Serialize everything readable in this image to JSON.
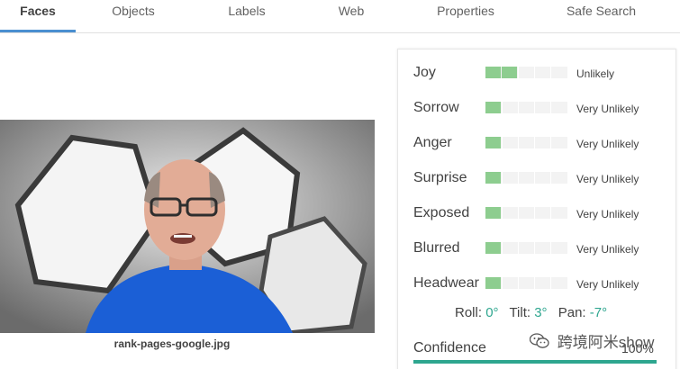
{
  "tabs": [
    {
      "label": "Faces",
      "active": true
    },
    {
      "label": "Objects",
      "active": false
    },
    {
      "label": "Labels",
      "active": false
    },
    {
      "label": "Web",
      "active": false
    },
    {
      "label": "Properties",
      "active": false
    },
    {
      "label": "Safe Search",
      "active": false
    }
  ],
  "image": {
    "filename": "rank-pages-google.jpg"
  },
  "attributes": [
    {
      "label": "Joy",
      "value": "Unlikely",
      "level": 2
    },
    {
      "label": "Sorrow",
      "value": "Very Unlikely",
      "level": 1
    },
    {
      "label": "Anger",
      "value": "Very Unlikely",
      "level": 1
    },
    {
      "label": "Surprise",
      "value": "Very Unlikely",
      "level": 1
    },
    {
      "label": "Exposed",
      "value": "Very Unlikely",
      "level": 1
    },
    {
      "label": "Blurred",
      "value": "Very Unlikely",
      "level": 1
    },
    {
      "label": "Headwear",
      "value": "Very Unlikely",
      "level": 1
    }
  ],
  "likelihood_levels_max": 5,
  "angles": {
    "roll_label": "Roll:",
    "roll": "0°",
    "tilt_label": "Tilt:",
    "tilt": "3°",
    "pan_label": "Pan:",
    "pan": "-7°"
  },
  "confidence": {
    "label": "Confidence",
    "value": "100%",
    "fraction": 1.0
  },
  "watermark": {
    "text": "跨境阿米show",
    "icon": "wechat-icon"
  },
  "colors": {
    "accent_tab": "#4a8fd0",
    "bar_fill": "#8dcd8f",
    "bar_empty": "#f3f3f3",
    "angle_value": "#2ea68f",
    "confidence_bar": "#2ea68f"
  }
}
